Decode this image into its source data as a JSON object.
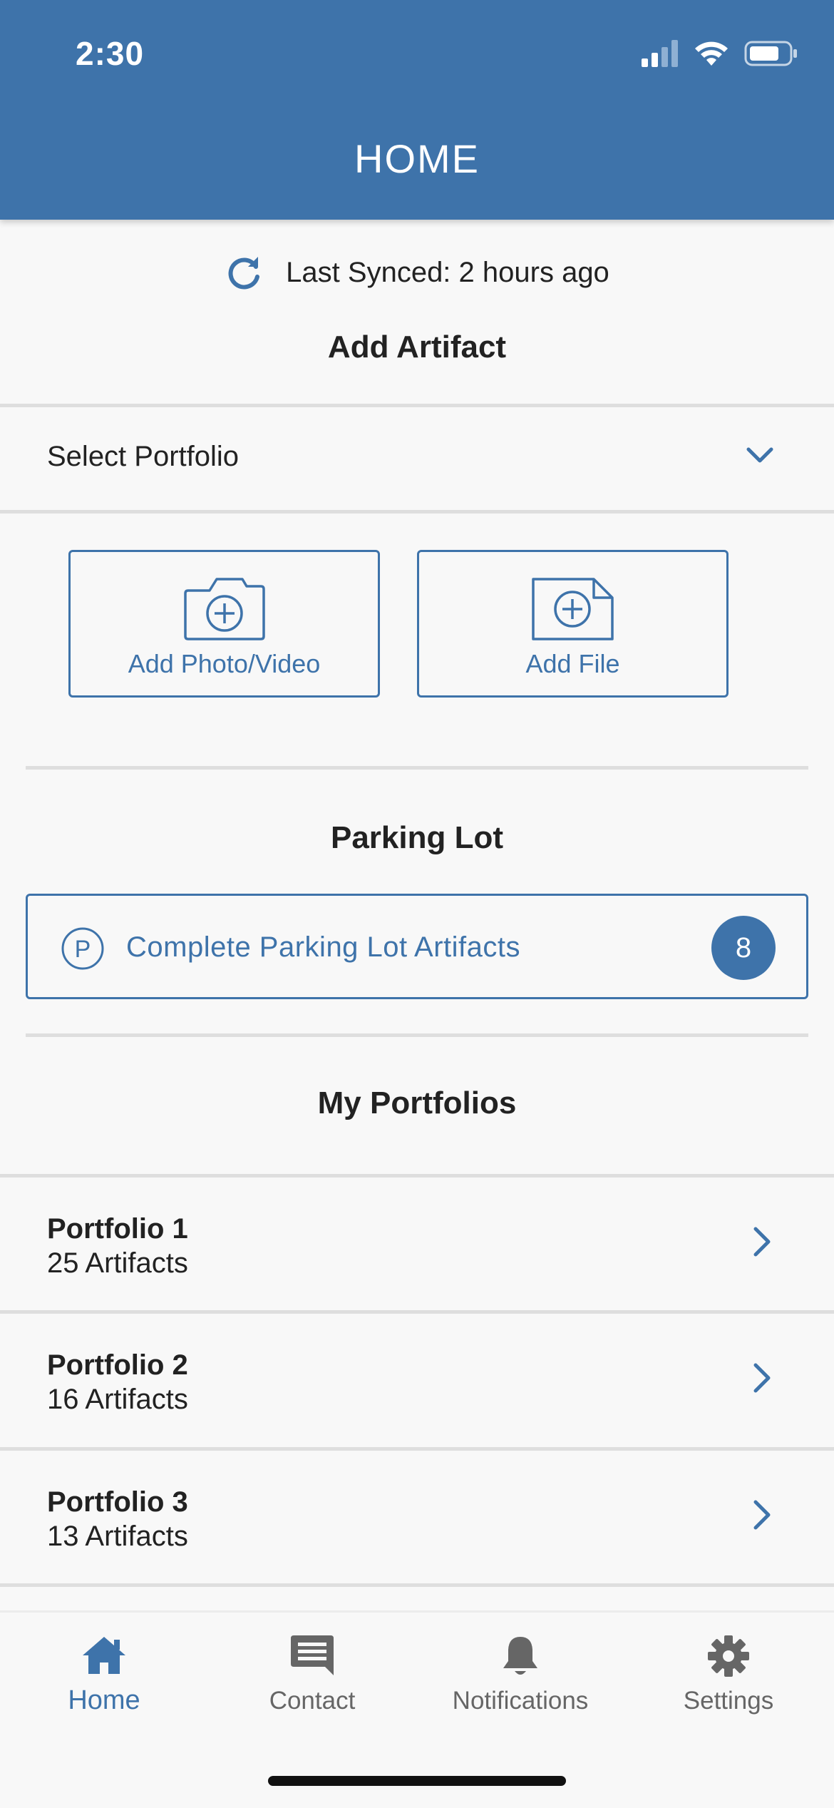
{
  "status_bar": {
    "time": "2:30"
  },
  "header": {
    "title": "HOME"
  },
  "sync": {
    "text": "Last Synced: 2 hours ago"
  },
  "add_artifact": {
    "title": "Add Artifact",
    "select_placeholder": "Select Portfolio",
    "photo_label": "Add Photo/Video",
    "file_label": "Add File"
  },
  "parking_lot": {
    "title": "Parking Lot",
    "button_label": "Complete Parking Lot Artifacts",
    "icon_letter": "P",
    "count": "8"
  },
  "portfolios": {
    "title": "My Portfolios",
    "items": [
      {
        "name": "Portfolio 1",
        "count": "25 Artifacts"
      },
      {
        "name": "Portfolio 2",
        "count": "16 Artifacts"
      },
      {
        "name": "Portfolio 3",
        "count": "13 Artifacts"
      }
    ]
  },
  "tabbar": {
    "tabs": [
      {
        "label": "Home",
        "icon": "home-icon"
      },
      {
        "label": "Contact",
        "icon": "chat-icon"
      },
      {
        "label": "Notifications",
        "icon": "bell-icon"
      },
      {
        "label": "Settings",
        "icon": "gear-icon"
      }
    ],
    "active": "Home"
  },
  "colors": {
    "accent": "#3e73aa",
    "background": "#f8f8f8",
    "divider": "#dedede",
    "inactive": "#666666"
  }
}
